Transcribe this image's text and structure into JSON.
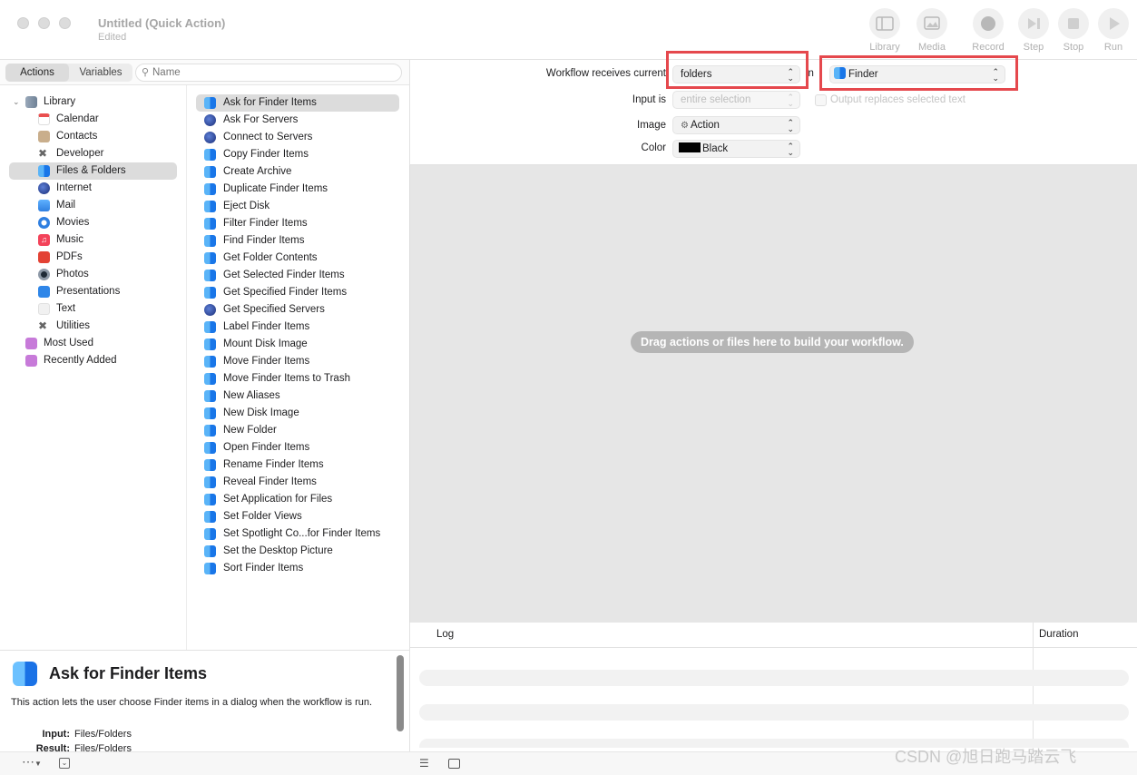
{
  "window": {
    "title": "Untitled (Quick Action)",
    "subtitle": "Edited"
  },
  "toolbar": [
    {
      "label": "Library",
      "icon": "sidebar-icon"
    },
    {
      "label": "Media",
      "icon": "photo-icon"
    },
    {
      "label": "Record",
      "icon": "record-icon"
    },
    {
      "label": "Step",
      "icon": "step-icon"
    },
    {
      "label": "Stop",
      "icon": "stop-icon"
    },
    {
      "label": "Run",
      "icon": "play-icon"
    }
  ],
  "tabs": {
    "actions": "Actions",
    "variables": "Variables"
  },
  "search": {
    "placeholder": "Name",
    "value": ""
  },
  "categories": [
    {
      "label": "Library",
      "icon": "library-icon",
      "color": "#7d8ea3"
    },
    {
      "label": "Calendar",
      "icon": "calendar-icon",
      "color": "#e94f4f"
    },
    {
      "label": "Contacts",
      "icon": "contacts-icon",
      "color": "#b39878"
    },
    {
      "label": "Developer",
      "icon": "developer-icon",
      "color": "#6b6b6b"
    },
    {
      "label": "Files & Folders",
      "icon": "finder-icon",
      "color": "#2b8cf0"
    },
    {
      "label": "Internet",
      "icon": "globe-icon",
      "color": "#1b2e78"
    },
    {
      "label": "Mail",
      "icon": "mail-icon",
      "color": "#3a8ff0"
    },
    {
      "label": "Movies",
      "icon": "quicktime-icon",
      "color": "#2f7fe0"
    },
    {
      "label": "Music",
      "icon": "music-icon",
      "color": "#f3435a"
    },
    {
      "label": "PDFs",
      "icon": "pdf-icon",
      "color": "#e34234"
    },
    {
      "label": "Photos",
      "icon": "camera-icon",
      "color": "#5f6a79"
    },
    {
      "label": "Presentations",
      "icon": "keynote-icon",
      "color": "#2f86e8"
    },
    {
      "label": "Text",
      "icon": "text-icon",
      "color": "#eeeeee"
    },
    {
      "label": "Utilities",
      "icon": "utilities-icon",
      "color": "#6b6b6b"
    },
    {
      "label": "Most Used",
      "icon": "smart-folder-icon",
      "color": "#c77ad9"
    },
    {
      "label": "Recently Added",
      "icon": "smart-folder-icon",
      "color": "#c77ad9"
    }
  ],
  "actions": [
    {
      "label": "Ask for Finder Items",
      "icon": "finder-icon"
    },
    {
      "label": "Ask For Servers",
      "icon": "globe-icon"
    },
    {
      "label": "Connect to Servers",
      "icon": "globe-icon"
    },
    {
      "label": "Copy Finder Items",
      "icon": "finder-icon"
    },
    {
      "label": "Create Archive",
      "icon": "finder-icon"
    },
    {
      "label": "Duplicate Finder Items",
      "icon": "finder-icon"
    },
    {
      "label": "Eject Disk",
      "icon": "finder-icon"
    },
    {
      "label": "Filter Finder Items",
      "icon": "finder-icon"
    },
    {
      "label": "Find Finder Items",
      "icon": "finder-icon"
    },
    {
      "label": "Get Folder Contents",
      "icon": "finder-icon"
    },
    {
      "label": "Get Selected Finder Items",
      "icon": "finder-icon"
    },
    {
      "label": "Get Specified Finder Items",
      "icon": "finder-icon"
    },
    {
      "label": "Get Specified Servers",
      "icon": "globe-icon"
    },
    {
      "label": "Label Finder Items",
      "icon": "finder-icon"
    },
    {
      "label": "Mount Disk Image",
      "icon": "finder-icon"
    },
    {
      "label": "Move Finder Items",
      "icon": "finder-icon"
    },
    {
      "label": "Move Finder Items to Trash",
      "icon": "finder-icon"
    },
    {
      "label": "New Aliases",
      "icon": "finder-icon"
    },
    {
      "label": "New Disk Image",
      "icon": "finder-icon"
    },
    {
      "label": "New Folder",
      "icon": "finder-icon"
    },
    {
      "label": "Open Finder Items",
      "icon": "finder-icon"
    },
    {
      "label": "Rename Finder Items",
      "icon": "finder-icon"
    },
    {
      "label": "Reveal Finder Items",
      "icon": "finder-icon"
    },
    {
      "label": "Set Application for Files",
      "icon": "finder-icon"
    },
    {
      "label": "Set Folder Views",
      "icon": "finder-icon"
    },
    {
      "label": "Set Spotlight Co...for Finder Items",
      "icon": "finder-icon"
    },
    {
      "label": "Set the Desktop Picture",
      "icon": "finder-icon"
    },
    {
      "label": "Sort Finder Items",
      "icon": "finder-icon"
    }
  ],
  "description": {
    "title": "Ask for Finder Items",
    "text": "This action lets the user choose Finder items in a dialog when the workflow is run.",
    "input_label": "Input:",
    "input_value": "Files/Folders",
    "result_label": "Result:",
    "result_value": "Files/Folders"
  },
  "workflow": {
    "receives_label": "Workflow receives current",
    "receives_value": "folders",
    "in_label": "in",
    "in_value": "Finder",
    "input_is_label": "Input is",
    "input_is_value": "entire selection",
    "output_replaces_label": "Output replaces selected text",
    "image_label": "Image",
    "image_value": "Action",
    "color_label": "Color",
    "color_value": "Black",
    "color_swatch": "#000000",
    "highlight_color": "#e5484d"
  },
  "drop_hint": "Drag actions or files here to build your workflow.",
  "log": {
    "col_log": "Log",
    "col_duration": "Duration"
  },
  "watermark": "CSDN @旭日跑马踏云飞"
}
